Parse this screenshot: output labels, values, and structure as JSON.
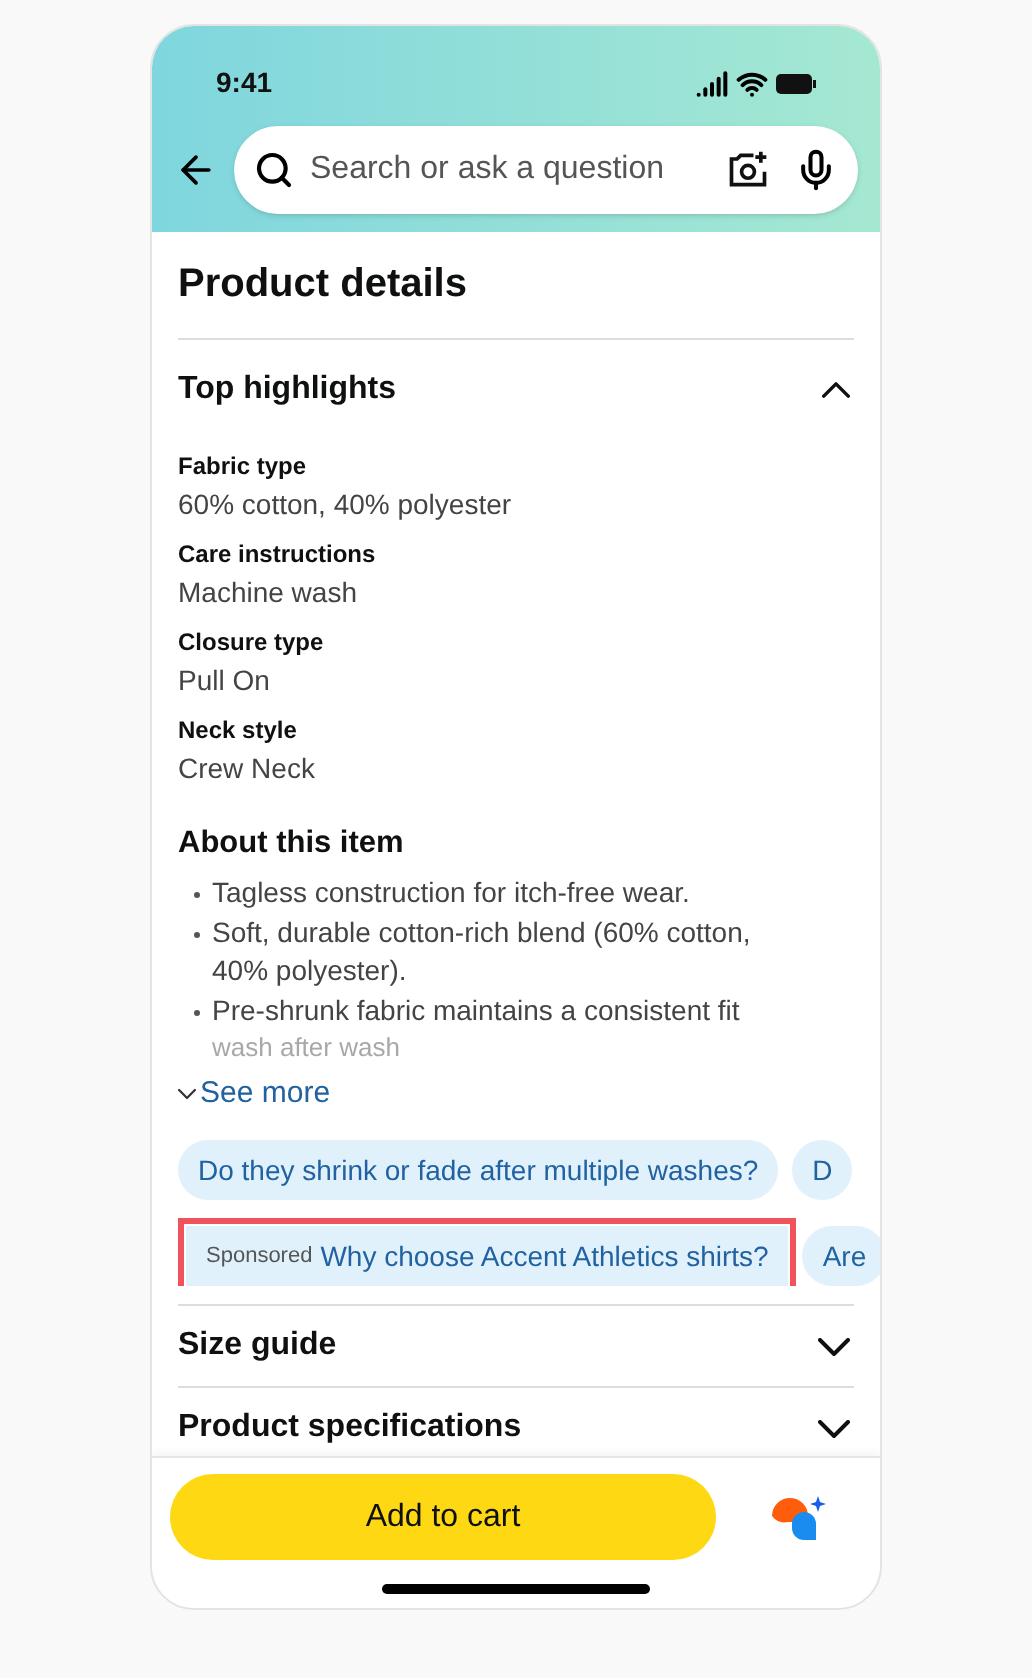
{
  "status_bar": {
    "time": "9:41"
  },
  "search": {
    "placeholder": "Search or ask a question"
  },
  "title": "Product details",
  "top_highlights": {
    "title": "Top highlights",
    "expanded": true,
    "fields": [
      {
        "label": "Fabric type",
        "value": "60% cotton, 40% polyester"
      },
      {
        "label": "Care instructions",
        "value": "Machine wash"
      },
      {
        "label": "Closure type",
        "value": "Pull On"
      },
      {
        "label": "Neck style",
        "value": "Crew Neck"
      }
    ]
  },
  "about": {
    "title": "About this item",
    "bullets": [
      "Tagless construction for itch-free wear.",
      "Soft, durable cotton-rich blend (60% cotton, 40% polyester).",
      "Pre-shrunk fabric maintains a consistent fit"
    ],
    "faded_line": "wash after wash",
    "see_more": "See more"
  },
  "chip_rows": [
    [
      {
        "text": "Do they shrink or fade after multiple washes?",
        "highlighted": false
      },
      {
        "text": "D",
        "highlighted": false
      }
    ],
    [
      {
        "tag": "Sponsored",
        "text": "Why choose Accent Athletics shirts?",
        "highlighted": true
      },
      {
        "text": "Are",
        "highlighted": false
      }
    ]
  ],
  "sections": [
    {
      "title": "Size guide",
      "expanded": false
    },
    {
      "title": "Product specifications",
      "expanded": false
    }
  ],
  "add_to_cart": "Add to cart"
}
